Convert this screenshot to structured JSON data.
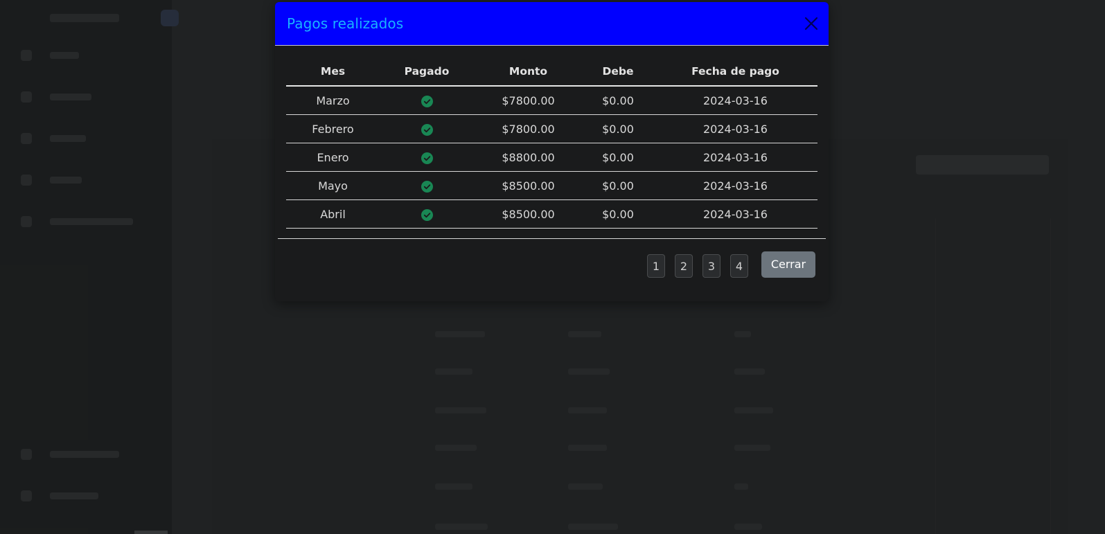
{
  "modal": {
    "title": "Pagos realizados",
    "close_icon": "close-icon",
    "table": {
      "headers": [
        "Mes",
        "Pagado",
        "Monto",
        "Debe",
        "Fecha de pago"
      ],
      "rows": [
        {
          "mes": "Marzo",
          "pagado": "check-circle-icon",
          "monto": "$7800.00",
          "debe": "$0.00",
          "fecha": "2024-03-16"
        },
        {
          "mes": "Febrero",
          "pagado": "check-circle-icon",
          "monto": "$7800.00",
          "debe": "$0.00",
          "fecha": "2024-03-16"
        },
        {
          "mes": "Enero",
          "pagado": "check-circle-icon",
          "monto": "$8800.00",
          "debe": "$0.00",
          "fecha": "2024-03-16"
        },
        {
          "mes": "Mayo",
          "pagado": "check-circle-icon",
          "monto": "$8500.00",
          "debe": "$0.00",
          "fecha": "2024-03-16"
        },
        {
          "mes": "Abril",
          "pagado": "check-circle-icon",
          "monto": "$8500.00",
          "debe": "$0.00",
          "fecha": "2024-03-16"
        }
      ]
    },
    "pagination": [
      "1",
      "2",
      "3",
      "4"
    ],
    "close_button_label": "Cerrar"
  },
  "colors": {
    "header_bg": "#0000ff",
    "title": "#19b3ff",
    "check": "#198754",
    "close_button_bg": "#6c757d"
  }
}
